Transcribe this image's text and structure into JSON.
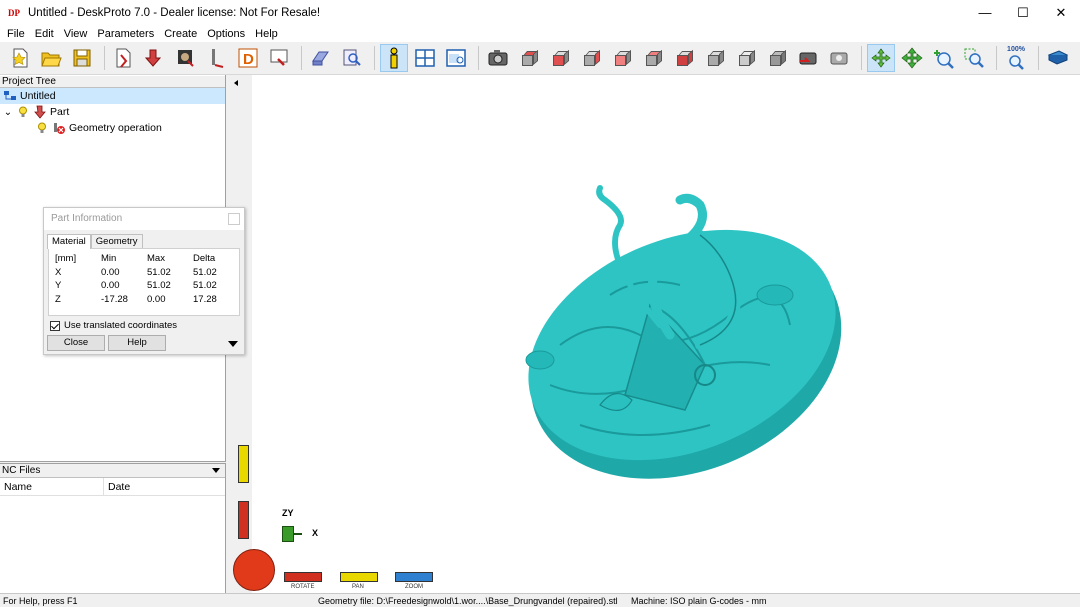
{
  "window": {
    "title": "Untitled - DeskProto 7.0 - Dealer license: Not For Resale!",
    "logo_text": "DP",
    "minimize": "—",
    "maximize": "☐",
    "close": "✕"
  },
  "menu": [
    "File",
    "Edit",
    "View",
    "Parameters",
    "Create",
    "Options",
    "Help"
  ],
  "toolbar": {
    "zoom_label": "100%"
  },
  "project_tree": {
    "header": "Project Tree",
    "root": "Untitled",
    "part": "Part",
    "operation": "Geometry operation"
  },
  "nc_files": {
    "header": "NC Files",
    "columns": [
      "Name",
      "Date"
    ]
  },
  "part_info": {
    "title": "Part Information",
    "tabs": [
      "Material",
      "Geometry"
    ],
    "headers": [
      "[mm]",
      "Min",
      "Max",
      "Delta"
    ],
    "rows": [
      [
        "X",
        "0.00",
        "51.02",
        "51.02"
      ],
      [
        "Y",
        "0.00",
        "51.02",
        "51.02"
      ],
      [
        "Z",
        "-17.28",
        "0.00",
        "17.28"
      ]
    ],
    "checkbox_label": "Use translated coordinates",
    "close_button": "Close",
    "help_button": "Help"
  },
  "viewport": {
    "axis_zy": "ZY",
    "axis_x": "X",
    "modes": [
      "ROTATE",
      "PAN",
      "ZOOM"
    ],
    "model_color": "#2ec4c4"
  },
  "status": {
    "help": "For Help, press F1",
    "geometry": "Geometry file: D:\\Freedesignwold\\1.wor....\\Base_Drungvandel (repaired).stl",
    "machine": "Machine: ISO plain G-codes - mm"
  }
}
